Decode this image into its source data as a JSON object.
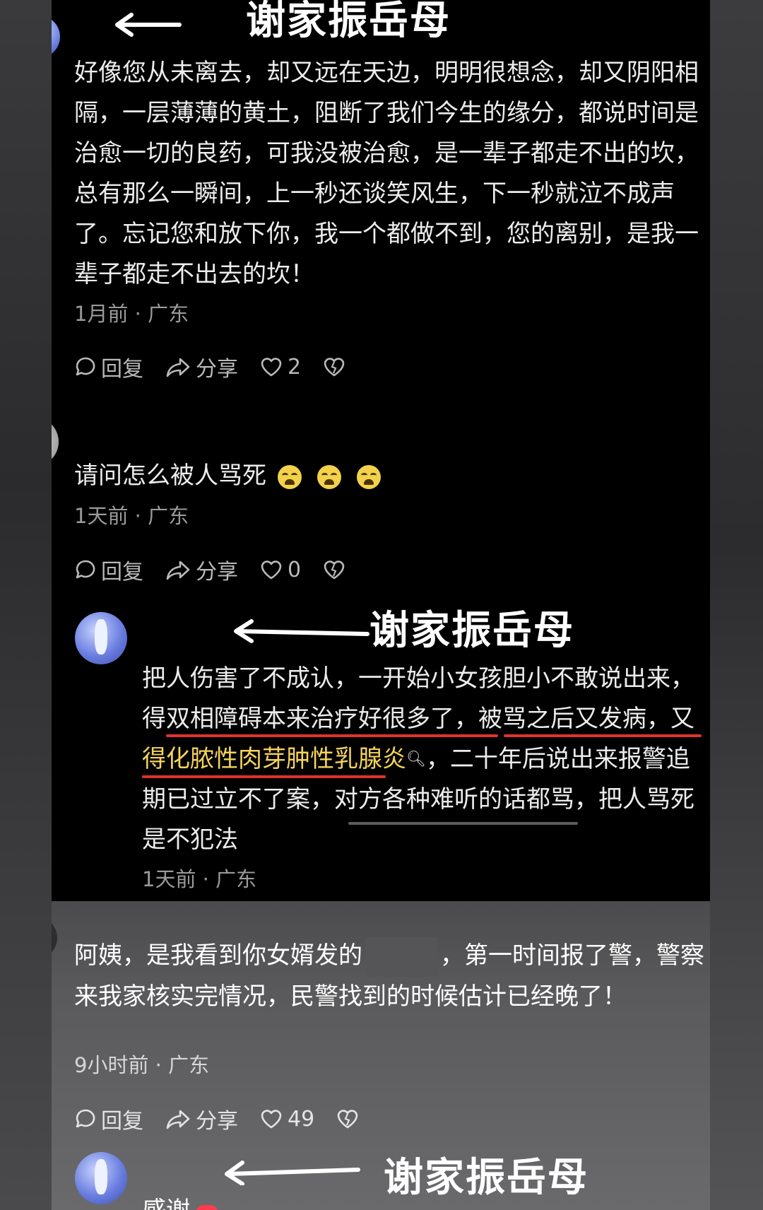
{
  "overlay": {
    "heading": "谢家振岳母"
  },
  "comments": [
    {
      "lines": [
        "好像您从未离去，却又远在天边，明明很想念，却又阴阳相",
        "隔，一层薄薄的黄土，阻断了我们今生的缘分，都说时间是",
        "治愈一切的良药，可我没被治愈，是一辈子都走不出的坎，",
        "总有那么一瞬间，上一秒还谈笑风生，下一秒就泣不成声",
        "了。忘记您和放下你，我一个都做不到，您的离别，是我一",
        "辈子都走不出去的坎！"
      ],
      "meta": "1月前 · 广东",
      "reply": "回复",
      "share": "分享",
      "likes": "2"
    },
    {
      "text": "请问怎么被人骂死",
      "emojis": [
        "crying-face",
        "crying-face",
        "crying-face"
      ],
      "meta": "1天前 · 广东",
      "reply": "回复",
      "share": "分享",
      "likes": "0"
    },
    {
      "line1": "把人伤害了不成认，一开始小女孩胆小不敢说出来，",
      "line2_a": "得",
      "line2_b": "双相障碍本来治疗好很多了",
      "line2_c": "，",
      "line2_d": "被骂之后又发病",
      "line2_e": "，又",
      "line3_a": "得",
      "line3_b": "化脓性肉芽肿性乳腺炎",
      "line3_c": "，二十年后说出来报警追",
      "line4": "期已过立不了案，对方各种难听的话都骂，把人骂死",
      "line5": "是不犯法",
      "meta": "1天前 · 广东"
    },
    {
      "line1_a": "阿姨，是我看到你女婿发的",
      "line1_b": "，第一时间报了警，警察",
      "line2": "来我家核实完情况，民警找到的时候估计已经晚了！",
      "meta": "9小时前 · 广东",
      "reply": "回复",
      "share": "分享",
      "likes": "49"
    },
    {
      "partial": "感谢"
    }
  ],
  "colors": {
    "accent_red": "#e0332c",
    "highlight_yellow": "#f5d35b"
  }
}
